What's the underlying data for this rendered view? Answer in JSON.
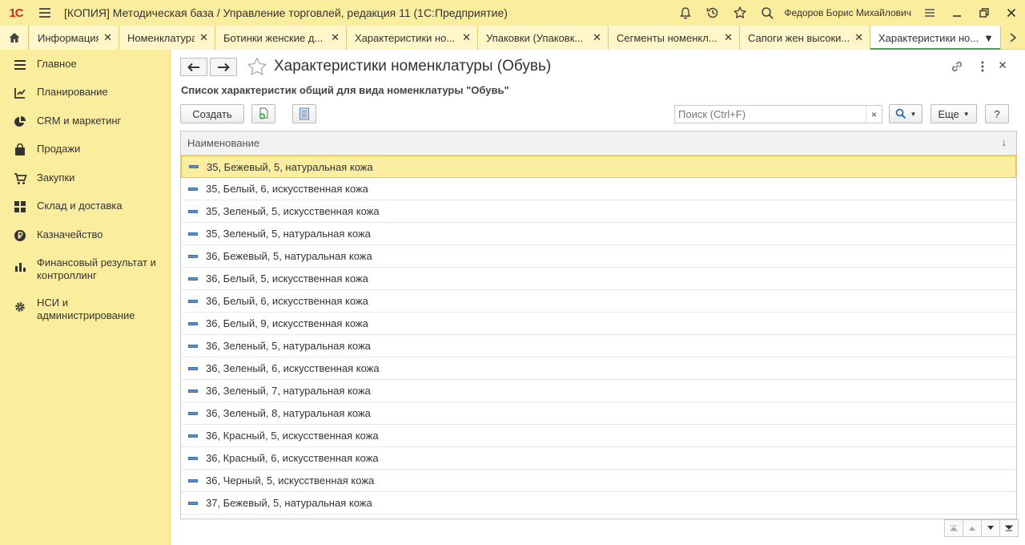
{
  "titlebar": {
    "logo": "1С",
    "title": "[КОПИЯ] Методическая база / Управление торговлей, редакция 11  (1С:Предприятие)",
    "user": "Федоров Борис Михайлович"
  },
  "tabs": [
    {
      "label": "Информация",
      "active": false
    },
    {
      "label": "Номенклатура",
      "active": false
    },
    {
      "label": "Ботинки женские д...",
      "active": false
    },
    {
      "label": "Характеристики но...",
      "active": false
    },
    {
      "label": "Упаковки (Упаковк...",
      "active": false
    },
    {
      "label": "Сегменты номенкл...",
      "active": false
    },
    {
      "label": "Сапоги жен высоки...",
      "active": false
    },
    {
      "label": "Характеристики но...",
      "active": true
    }
  ],
  "sidebar": {
    "items": [
      {
        "label": "Главное",
        "icon": "menu-lines-icon"
      },
      {
        "label": "Планирование",
        "icon": "planning-icon"
      },
      {
        "label": "CRM и маркетинг",
        "icon": "pie-icon"
      },
      {
        "label": "Продажи",
        "icon": "bag-icon"
      },
      {
        "label": "Закупки",
        "icon": "cart-icon"
      },
      {
        "label": "Склад и доставка",
        "icon": "grid-icon"
      },
      {
        "label": "Казначейство",
        "icon": "ruble-icon"
      },
      {
        "label": "Финансовый результат и контроллинг",
        "icon": "bar-chart-icon"
      },
      {
        "label": "НСИ и администрирование",
        "icon": "gear-icon"
      }
    ]
  },
  "page": {
    "title": "Характеристики номенклатуры (Обувь)",
    "subtitle": "Список характеристик общий для вида номенклатуры \"Обувь\""
  },
  "toolbar": {
    "create_label": "Создать",
    "more_label": "Еще",
    "help_label": "?",
    "search_placeholder": "Поиск (Ctrl+F)",
    "search_clear": "×"
  },
  "table": {
    "column": "Наименование",
    "sort": "↓",
    "rows": [
      "35, Бежевый, 5, натуральная кожа",
      "35, Белый, 6, искусственная кожа",
      "35, Зеленый, 5, искусственная кожа",
      "35, Зеленый, 5, натуральная кожа",
      "36, Бежевый, 5, натуральная кожа",
      "36, Белый, 5, искусственная кожа",
      "36, Белый, 6, искусственная кожа",
      "36, Белый, 9, искусственная кожа",
      "36, Зеленый, 5, натуральная кожа",
      "36, Зеленый, 6, искусственная кожа",
      "36, Зеленый, 7, натуральная кожа",
      "36, Зеленый, 8, натуральная кожа",
      "36, Красный, 5, искусственная кожа",
      "36, Красный, 6, искусственная кожа",
      "36, Черный, 5, искусственная кожа",
      "37, Бежевый, 5, натуральная кожа"
    ],
    "selected_index": 0
  },
  "colors": {
    "panel": "#fbed9e",
    "selection": "#fbeea0",
    "accent_green": "#4a9e5c",
    "logo_red": "#d42b1e"
  }
}
